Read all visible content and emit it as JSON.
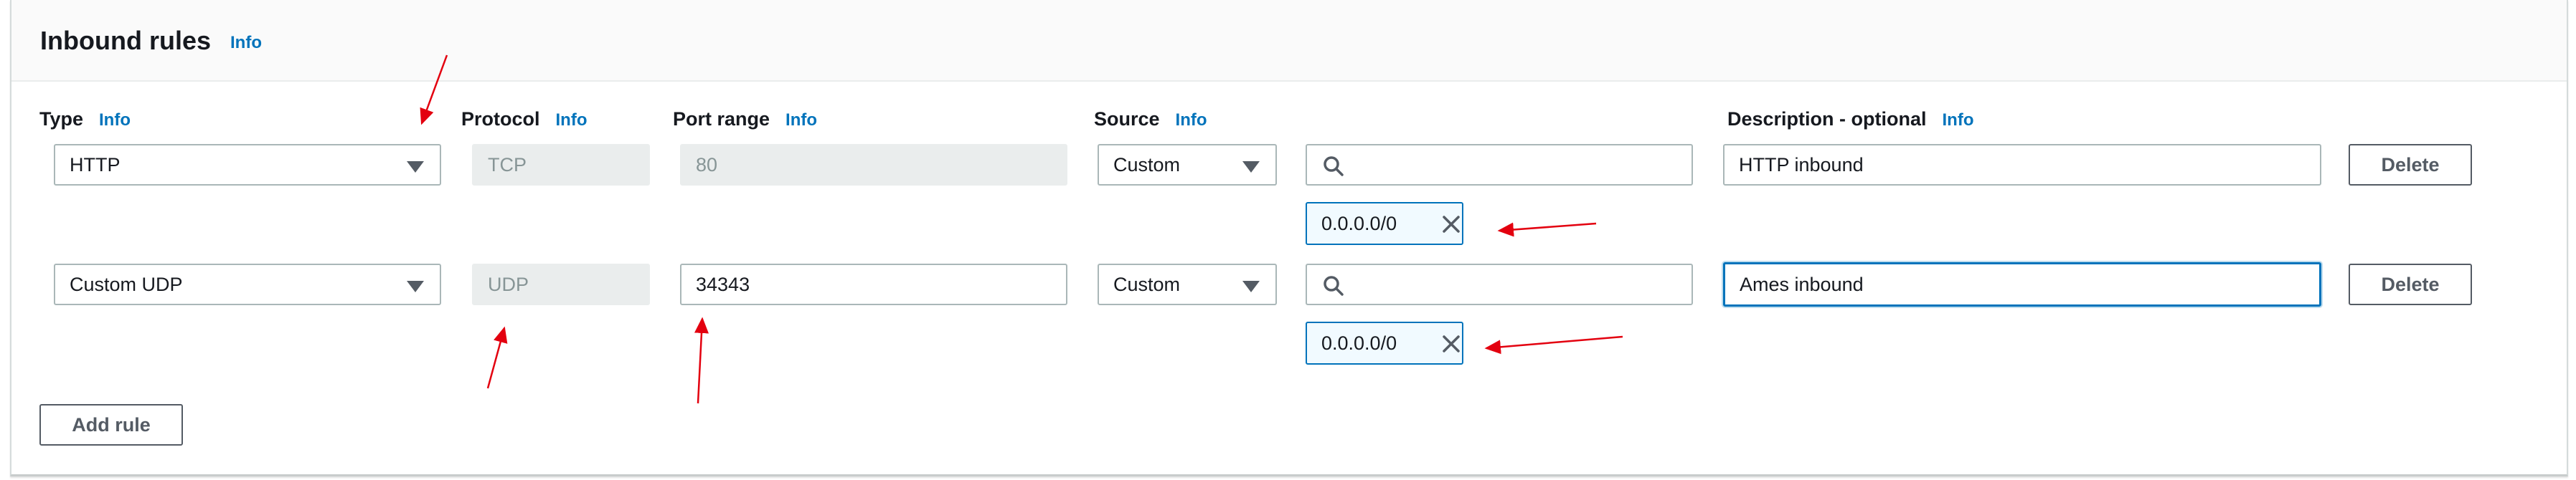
{
  "header": {
    "title": "Inbound rules",
    "info_link": "Info"
  },
  "columns": {
    "type": "Type",
    "protocol": "Protocol",
    "port_range": "Port range",
    "source": "Source",
    "description": "Description - optional",
    "info_link": "Info"
  },
  "rules": [
    {
      "type": "HTTP",
      "protocol": "TCP",
      "port_range": "80",
      "source": "Custom",
      "search_value": "",
      "cidr_token": "0.0.0.0/0",
      "description": "HTTP inbound",
      "delete_label": "Delete"
    },
    {
      "type": "Custom UDP",
      "protocol": "UDP",
      "port_range": "34343",
      "source": "Custom",
      "search_value": "",
      "cidr_token": "0.0.0.0/0",
      "description": "Ames inbound",
      "delete_label": "Delete"
    }
  ],
  "add_rule_label": "Add rule",
  "icons": {
    "dropdown": "caret-down-icon",
    "search": "search-icon",
    "remove": "close-icon"
  },
  "colors": {
    "info_link": "#0073bb",
    "annotation_arrow": "#e3000f",
    "focus": "#0073bb"
  }
}
